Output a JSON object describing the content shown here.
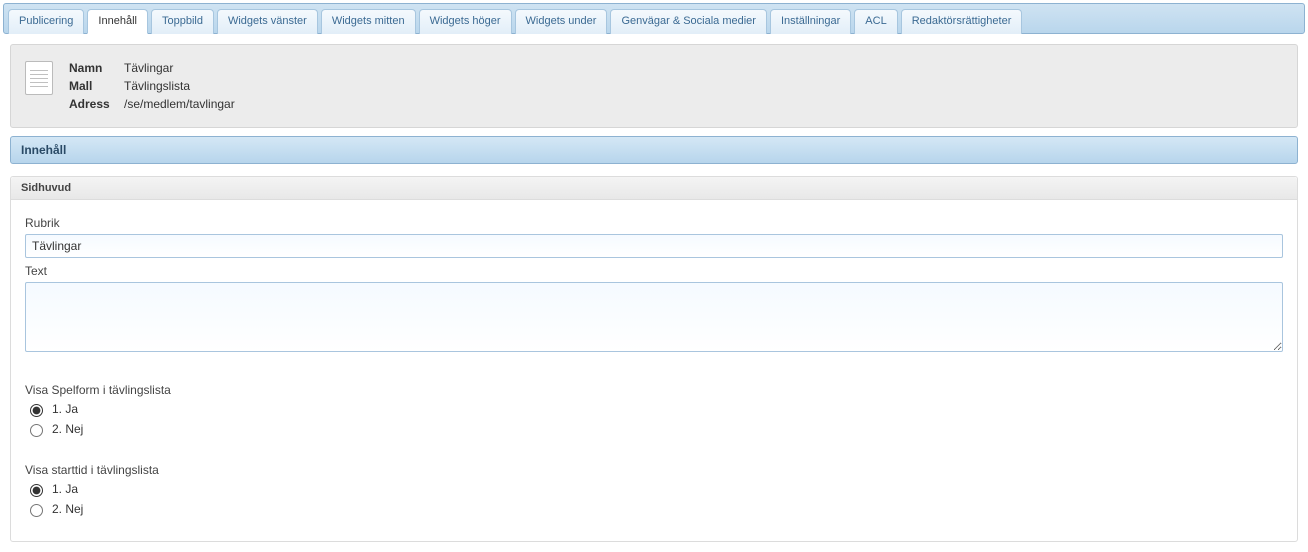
{
  "tabs": [
    {
      "label": "Publicering"
    },
    {
      "label": "Innehåll"
    },
    {
      "label": "Toppbild"
    },
    {
      "label": "Widgets vänster"
    },
    {
      "label": "Widgets mitten"
    },
    {
      "label": "Widgets höger"
    },
    {
      "label": "Widgets under"
    },
    {
      "label": "Genvägar & Sociala medier"
    },
    {
      "label": "Inställningar"
    },
    {
      "label": "ACL"
    },
    {
      "label": "Redaktörsrättigheter"
    }
  ],
  "info": {
    "labels": {
      "name": "Namn",
      "template": "Mall",
      "address": "Adress"
    },
    "name": "Tävlingar",
    "template": "Tävlingslista",
    "address": "/se/medlem/tavlingar"
  },
  "section": {
    "title": "Innehåll"
  },
  "form": {
    "header": "Sidhuvud",
    "rubrik_label": "Rubrik",
    "rubrik_value": "Tävlingar",
    "text_label": "Text",
    "text_value": "",
    "spelform": {
      "label": "Visa Spelform i tävlingslista",
      "options": [
        {
          "label": "1. Ja",
          "checked": true
        },
        {
          "label": "2. Nej",
          "checked": false
        }
      ]
    },
    "starttid": {
      "label": "Visa starttid i tävlingslista",
      "options": [
        {
          "label": "1. Ja",
          "checked": true
        },
        {
          "label": "2. Nej",
          "checked": false
        }
      ]
    }
  }
}
